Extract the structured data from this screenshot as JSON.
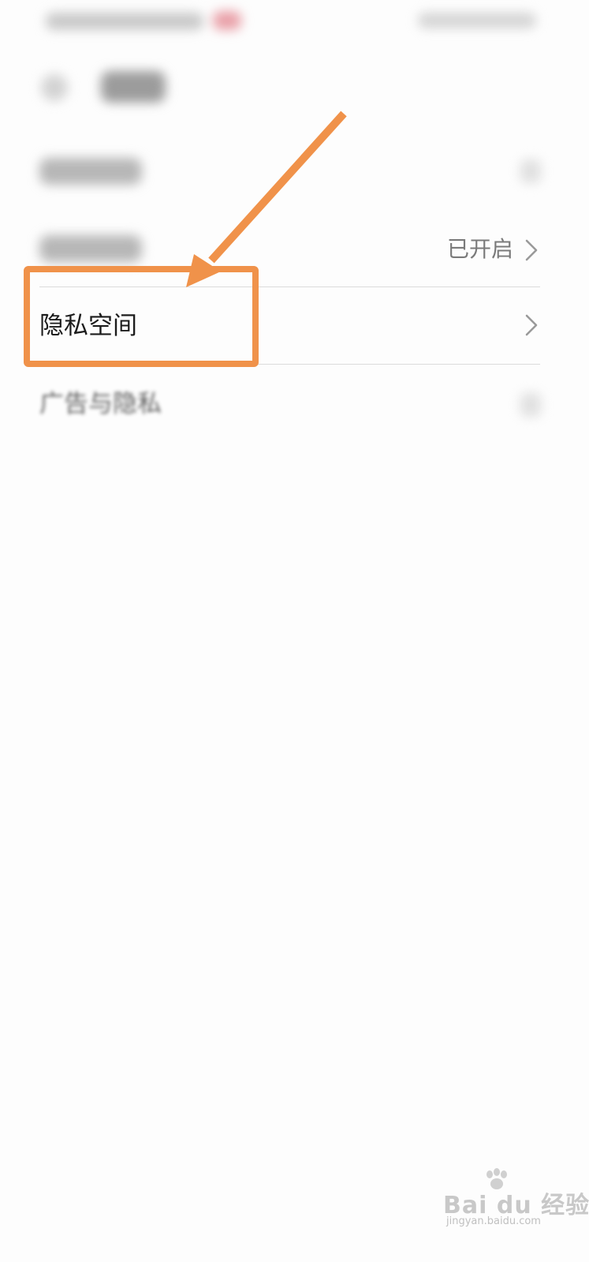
{
  "rows": {
    "row2": {
      "value": "已开启"
    },
    "private_space": {
      "label": "隐私空间"
    },
    "ads_privacy": {
      "label": "广告与隐私"
    }
  },
  "annotation": {
    "color": "#f0924a"
  },
  "watermark": {
    "brand": "Bai du 经验",
    "url": "jingyan.baidu.com"
  },
  "icons": {
    "chevron": "chevron-right-icon",
    "back": "back-arrow-icon",
    "paw": "baidu-paw-icon"
  }
}
